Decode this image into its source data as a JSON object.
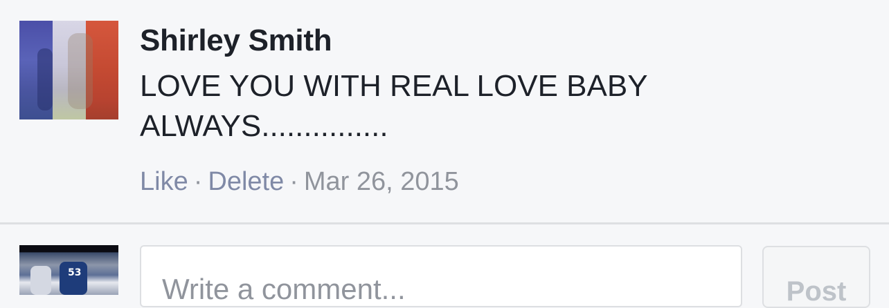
{
  "comment": {
    "author": "Shirley Smith",
    "text": "LOVE YOU WITH REAL LOVE BABY ALWAYS...............",
    "actions": {
      "like_label": "Like",
      "delete_label": "Delete",
      "separator": "·",
      "date": "Mar 26, 2015"
    }
  },
  "composer": {
    "placeholder": "Write a comment...",
    "post_label": "Post",
    "jersey_number": "53"
  },
  "colors": {
    "background": "#f6f7f9",
    "author_text": "#1d2129",
    "action_link": "#7f89a6",
    "meta_text": "#90949c",
    "divider": "#dddfe2"
  }
}
